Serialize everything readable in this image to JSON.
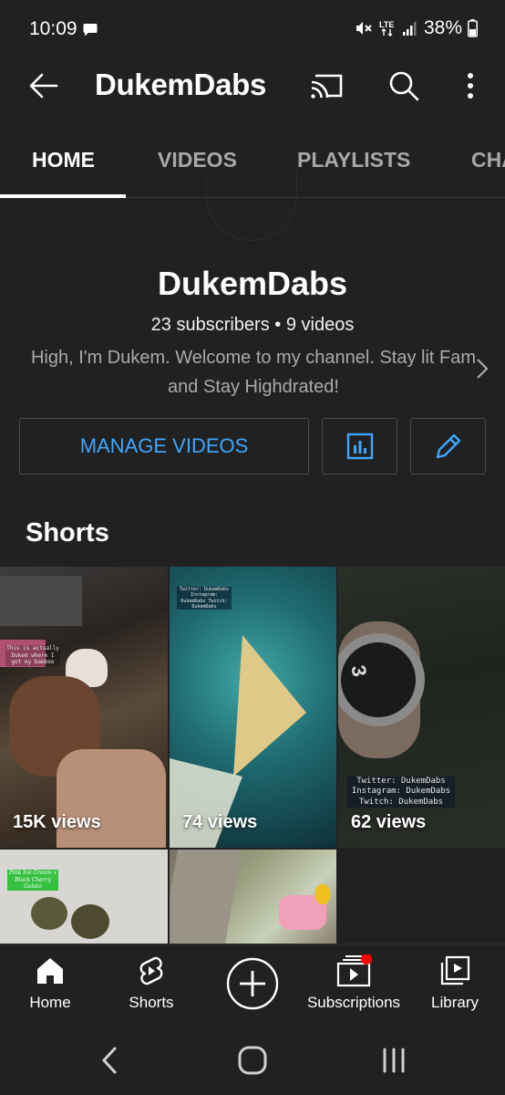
{
  "status_bar": {
    "time": "10:09",
    "battery": "38%",
    "network": "LTE"
  },
  "app_bar": {
    "title": "DukemDabs",
    "icons": [
      "back-arrow-icon",
      "cast-icon",
      "search-icon",
      "more-vertical-icon"
    ]
  },
  "tabs": [
    {
      "label": "HOME",
      "active": true
    },
    {
      "label": "VIDEOS",
      "active": false
    },
    {
      "label": "PLAYLISTS",
      "active": false
    },
    {
      "label": "CHA",
      "active": false
    }
  ],
  "channel": {
    "name": "DukemDabs",
    "meta": "23 subscribers • 9 videos",
    "description": "High, I'm Dukem. Welcome to my channel. Stay lit Fam and Stay Highdrated!"
  },
  "actions": {
    "manage_label": "MANAGE VIDEOS",
    "analytics_icon": "analytics-icon",
    "edit_icon": "pencil-icon",
    "accent_color": "#3ea6ff"
  },
  "shorts": {
    "title": "Shorts",
    "items": [
      {
        "views": "15K views",
        "caption": "This is actually Dukem where I got my bamboo"
      },
      {
        "views": "74 views",
        "caption": "Twitter: DukemDabs Instagram: DukemDabs Twitch: DukemDabs"
      },
      {
        "views": "62 views",
        "caption": "Twitter: DukemDabs Instagram: DukemDabs Twitch: DukemDabs"
      },
      {
        "views": "",
        "caption": "Pink Ice Cream x Black Cherry Gelato"
      },
      {
        "views": "",
        "caption": ""
      }
    ]
  },
  "bottom_nav": [
    {
      "label": "Home",
      "icon": "home-icon"
    },
    {
      "label": "Shorts",
      "icon": "shorts-icon"
    },
    {
      "label": "",
      "icon": "create-plus-icon"
    },
    {
      "label": "Subscriptions",
      "icon": "subscriptions-icon",
      "badge_color": "#ff0000"
    },
    {
      "label": "Library",
      "icon": "library-icon"
    }
  ],
  "system_nav": [
    "back-chevron-icon",
    "home-circle-icon",
    "recents-icon"
  ]
}
